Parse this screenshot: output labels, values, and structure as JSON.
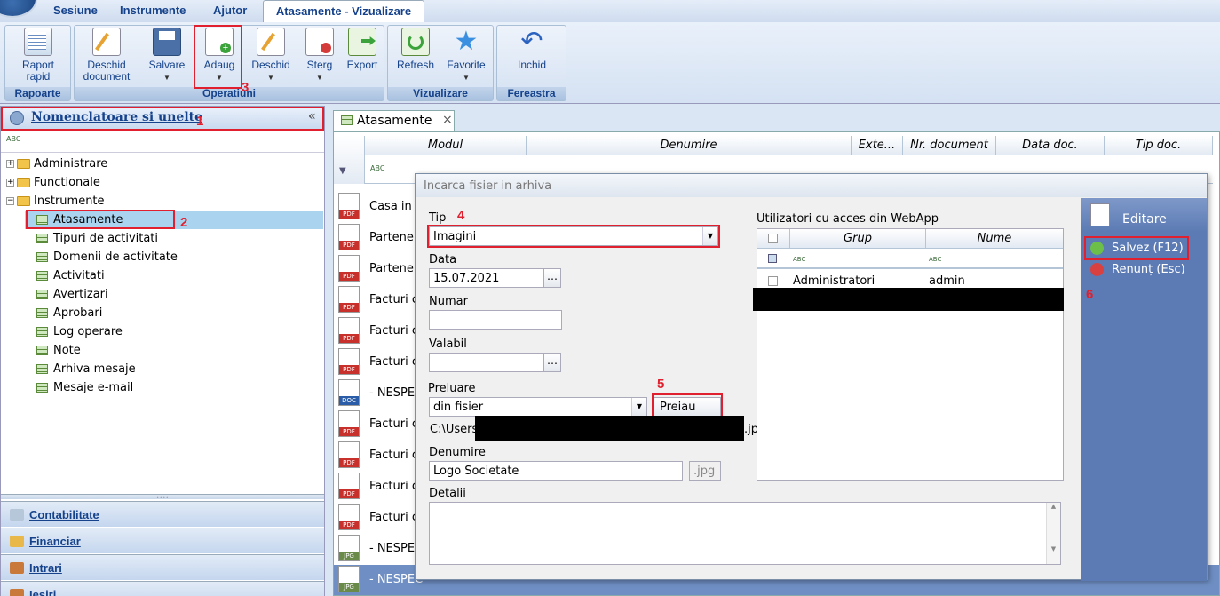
{
  "menu": {
    "tabs": [
      "Sesiune",
      "Instrumente",
      "Ajutor"
    ],
    "active_tab": "Atasamente - Vizualizare"
  },
  "ribbon": {
    "groups": {
      "rapoarte": "Rapoarte",
      "operatiuni": "Operatiuni",
      "vizualizare": "Vizualizare",
      "fereastra": "Fereastra"
    },
    "buttons": {
      "raport_rapid": [
        "Raport",
        "rapid"
      ],
      "deschid_document": [
        "Deschid",
        "document"
      ],
      "salvare": "Salvare",
      "adaug": "Adaug",
      "deschid": "Deschid",
      "sterg": "Sterg",
      "export": "Export",
      "refresh": "Refresh",
      "favorite": "Favorite",
      "inchid": "Inchid"
    }
  },
  "left_panel": {
    "title": "Nomenclatoare si unelte",
    "tree": [
      "Administrare",
      "Functionale",
      "Instrumente",
      "Atasamente",
      "Tipuri de activitati",
      "Domenii de activitate",
      "Activitati",
      "Avertizari",
      "Aprobari",
      "Log operare",
      "Note",
      "Arhiva mesaje",
      "Mesaje e-mail"
    ],
    "accordion": [
      "Contabilitate",
      "Financiar",
      "Intrari",
      "Iesiri"
    ]
  },
  "doc_tab": {
    "label": "Atasamente",
    "close": "×"
  },
  "grid": {
    "columns": [
      "Modul",
      "Denumire",
      "Exte...",
      "Nr. document",
      "Data doc.",
      "Tip doc."
    ],
    "rows": [
      {
        "type": "PDF",
        "modul": "Casa in"
      },
      {
        "type": "PDF",
        "modul": "Partener"
      },
      {
        "type": "PDF",
        "modul": "Partener"
      },
      {
        "type": "PDF",
        "modul": "Facturi c"
      },
      {
        "type": "PDF",
        "modul": "Facturi c"
      },
      {
        "type": "PDF",
        "modul": "Facturi c"
      },
      {
        "type": "DOC",
        "modul": "- NESPEC"
      },
      {
        "type": "PDF",
        "modul": "Facturi c"
      },
      {
        "type": "PDF",
        "modul": "Facturi c"
      },
      {
        "type": "PDF",
        "modul": "Facturi c"
      },
      {
        "type": "PDF",
        "modul": "Facturi c"
      },
      {
        "type": "JPG",
        "modul": "- NESPEC"
      },
      {
        "type": "JPG",
        "modul": "- NESPEC"
      }
    ]
  },
  "dialog": {
    "title": "Incarca fisier in arhiva",
    "tip_label": "Tip",
    "tip_value": "Imagini",
    "data_label": "Data",
    "data_value": "15.07.2021",
    "numar_label": "Numar",
    "numar_value": "",
    "valabil_label": "Valabil",
    "valabil_value": "",
    "preluare_label": "Preluare",
    "preluare_value": "din fisier",
    "preiau_button": "Preiau",
    "path_start": "C:\\Users",
    "path_end": ".jp",
    "denumire_label": "Denumire",
    "denumire_value": "Logo Societate",
    "ext_value": ".jpg",
    "detalii_label": "Detalii",
    "detalii_value": "",
    "users_label": "Utilizatori cu acces din WebApp",
    "users_cols": [
      "Grup",
      "Nume"
    ],
    "users_rows": [
      {
        "grup": "Administratori",
        "nume": "admin"
      }
    ],
    "editare": "Editare",
    "salvez": "Salvez (F12)",
    "renunt": "Renunț (Esc)"
  },
  "annotations": [
    "1",
    "2",
    "3",
    "4",
    "5",
    "6"
  ],
  "colors": {
    "accent": "#15428b",
    "annotation_red": "#e0202e",
    "side_bar": "#5c7bb4"
  }
}
